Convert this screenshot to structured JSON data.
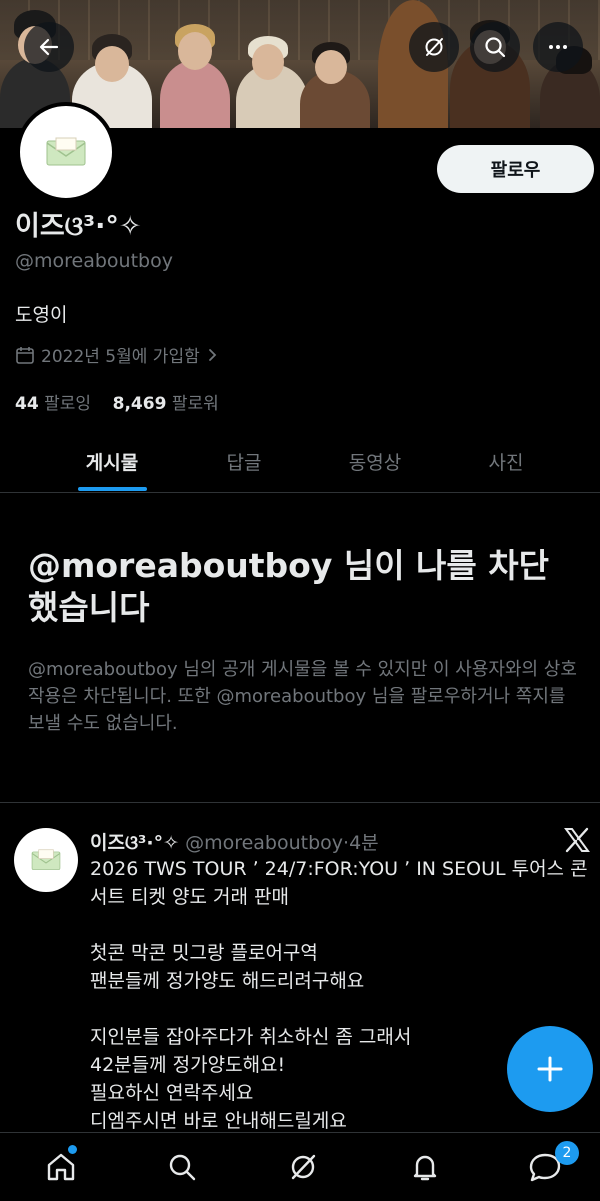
{
  "header": {
    "back_icon": "arrow-left-icon",
    "grok_icon": "grok-icon",
    "search_icon": "search-icon",
    "more_icon": "more-icon"
  },
  "profile": {
    "display_name": "이즈ଓ³·°✧",
    "handle": "@moreaboutboy",
    "bio": "도영이",
    "joined": "2022년 5월에 가입함",
    "following_count": "44",
    "following_label": "팔로잉",
    "followers_count": "8,469",
    "followers_label": "팔로워",
    "follow_button": "팔로우"
  },
  "tabs": [
    {
      "label": "게시물",
      "active": true
    },
    {
      "label": "답글",
      "active": false
    },
    {
      "label": "동영상",
      "active": false
    },
    {
      "label": "사진",
      "active": false
    }
  ],
  "blocked": {
    "title": "@moreaboutboy 님이 나를 차단했습니다",
    "description": "@moreaboutboy 님의 공개 게시물을 볼 수 있지만 이 사용자와의 상호작용은 차단됩니다. 또한 @moreaboutboy 님을 팔로우하거나 쪽지를 보낼 수도 없습니다."
  },
  "tweet": {
    "author": "이즈ଓ³·°✧",
    "handle": "@moreaboutboy",
    "separator": "·",
    "time": "4분",
    "lines": [
      "2026 TWS TOUR ʼ 24/7:FOR:YOU ʼ IN SEOUL 투어스 콘서트 티켓 양도 거래 판매",
      "",
      "첫콘 막콘 밋그랑 플로어구역",
      "팬분들께 정가양도 해드리려구해요",
      "",
      "지인분들 잡아주다가 취소하신 좀 그래서",
      "42분들께 정가양도해요!",
      "필요하신 연락주세요",
      "디엠주시면 바로 안내해드릴게요"
    ]
  },
  "bottom_nav": {
    "items": [
      "home-icon",
      "search-icon",
      "grok-icon",
      "notifications-icon",
      "messages-icon"
    ],
    "messages_badge": "2"
  },
  "colors": {
    "accent": "#1d9bf0",
    "background": "#000000",
    "secondary_text": "#71767b",
    "primary_text": "#e7e9ea"
  }
}
